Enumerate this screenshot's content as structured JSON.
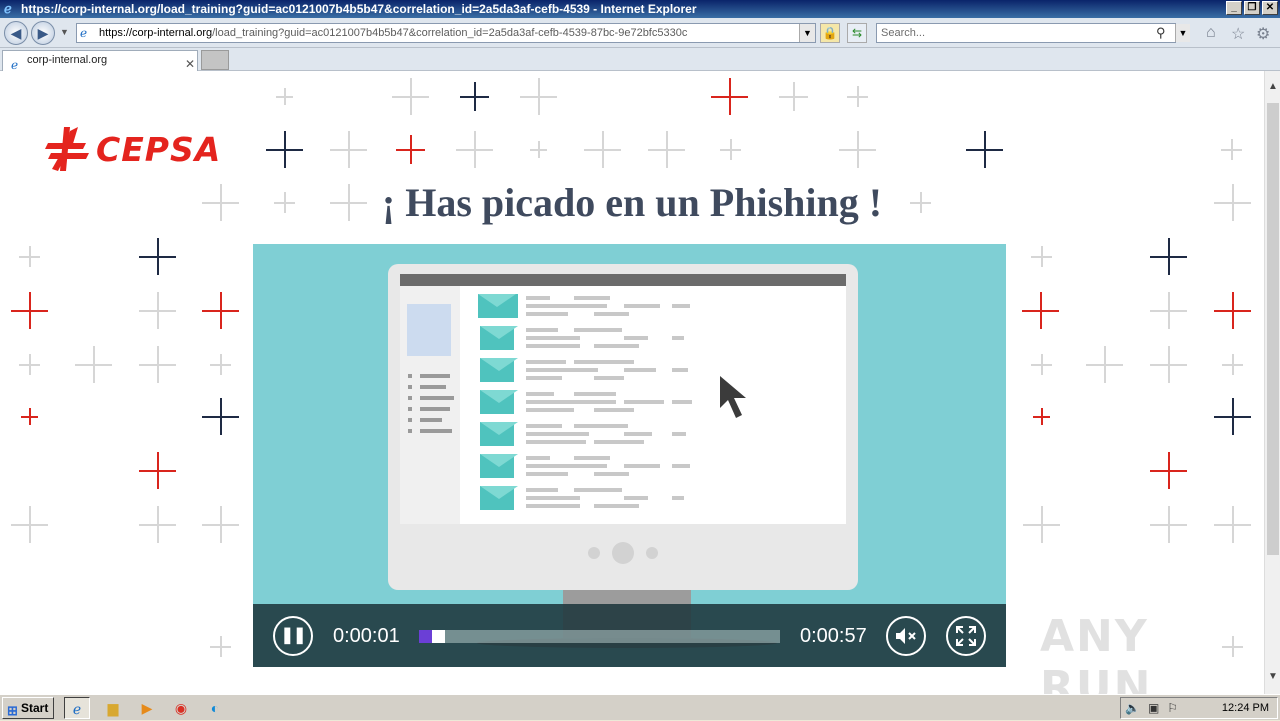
{
  "window": {
    "title": "https://corp-internal.org/load_training?guid=ac0121007b4b5b47&correlation_id=2a5da3af-cefb-4539 - Internet Explorer",
    "buttons": [
      "_",
      "❐",
      "✕"
    ]
  },
  "address_bar": {
    "url_host": "https://corp-internal.org",
    "url_path": "/load_training?guid=ac0121007b4b5b47&correlation_id=2a5da3af-cefb-4539-87bc-9e72bfc5330c",
    "search_placeholder": "Search..."
  },
  "tabs": [
    {
      "label": "corp-internal.org",
      "active": true
    }
  ],
  "page": {
    "logo_text": "CEPSA",
    "headline": "¡ Has picado en un Phishing !",
    "video": {
      "time_elapsed": "0:00:01",
      "time_total": "0:00:57",
      "progress_fraction": 0.035
    },
    "watermark": "ANY RUN"
  },
  "taskbar": {
    "start_label": "Start",
    "clock": "12:24 PM"
  },
  "colors": {
    "brand_red": "#e4241e",
    "headline": "#3f4a5e",
    "video_bg": "#7fcfd4",
    "progress": "#6b3fd6"
  }
}
